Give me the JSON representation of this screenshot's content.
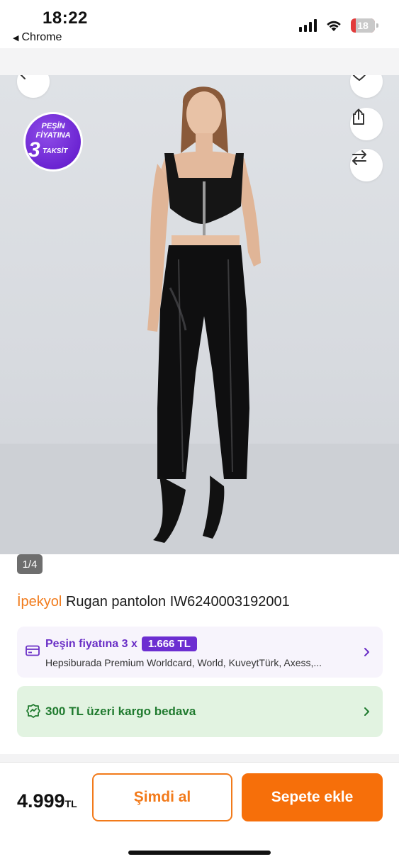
{
  "status_bar": {
    "time": "18:22",
    "back_app": "Chrome",
    "battery": "18"
  },
  "image": {
    "counter": "1/4",
    "badge": {
      "line1": "PEŞİN",
      "line2": "FİYATINA",
      "number": "3",
      "word": "TAKSİT"
    }
  },
  "product": {
    "brand": "İpekyol",
    "name": "Rugan pantolon IW6240003192001"
  },
  "installment": {
    "label": "Peşin fiyatına 3 x",
    "amount": "1.666 TL",
    "cards": "Hepsiburada Premium Worldcard, World, KuveytTürk, Axess,..."
  },
  "shipping": {
    "text": "300 TL üzeri kargo bedava"
  },
  "bottom": {
    "price": "4.999",
    "currency": "TL",
    "buy_now": "Şimdi al",
    "add_to_cart": "Sepete ekle"
  },
  "colors": {
    "brand_orange": "#f66f0a",
    "purple": "#6c2ed1",
    "green": "#1f7a2e"
  },
  "icons": [
    "back-arrow-icon",
    "favorite-list-icon",
    "share-icon",
    "compare-icon",
    "card-icon",
    "cargo-icon",
    "chevron-right-icon"
  ]
}
